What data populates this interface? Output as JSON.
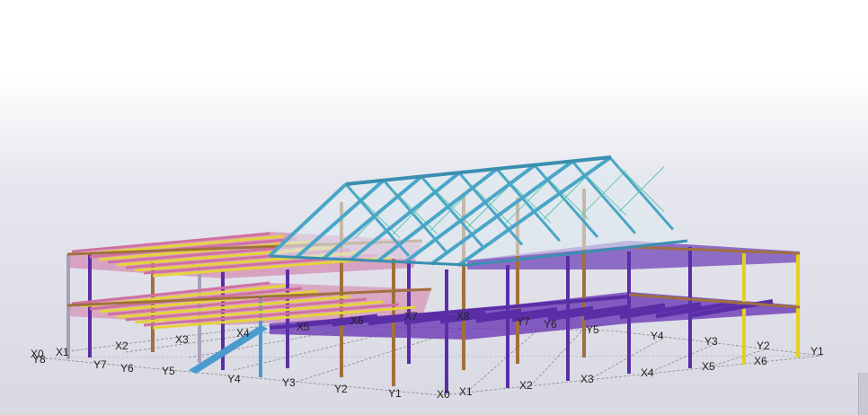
{
  "viewport": {
    "background_top": "#ffffff",
    "background_bottom": "#d9d9e3"
  },
  "colors": {
    "column_purple": "#5a2ea6",
    "column_brown": "#a0703f",
    "beam_pink": "#d070a0",
    "beam_yellow": "#e6d23a",
    "roof_teal": "#4aa6c8",
    "brace_green": "#5ec8b0",
    "column_yellow": "#e4d020",
    "grid_line": "#8a8a8a"
  },
  "grid_labels": {
    "front_x": [
      "X0",
      "X1",
      "X2",
      "X3",
      "X4",
      "X5"
    ],
    "front_y": [
      "Y8",
      "Y7",
      "Y6",
      "Y5",
      "Y4",
      "Y3",
      "Y2",
      "Y1"
    ],
    "back_x": [
      "X5",
      "X6",
      "X7",
      "X8"
    ],
    "back_y": [
      "Y7",
      "Y6",
      "Y5",
      "Y4",
      "Y3",
      "Y2",
      "Y1"
    ],
    "right_x": [
      "X0",
      "X1",
      "X2",
      "X3",
      "X4",
      "X5",
      "X6"
    ]
  }
}
